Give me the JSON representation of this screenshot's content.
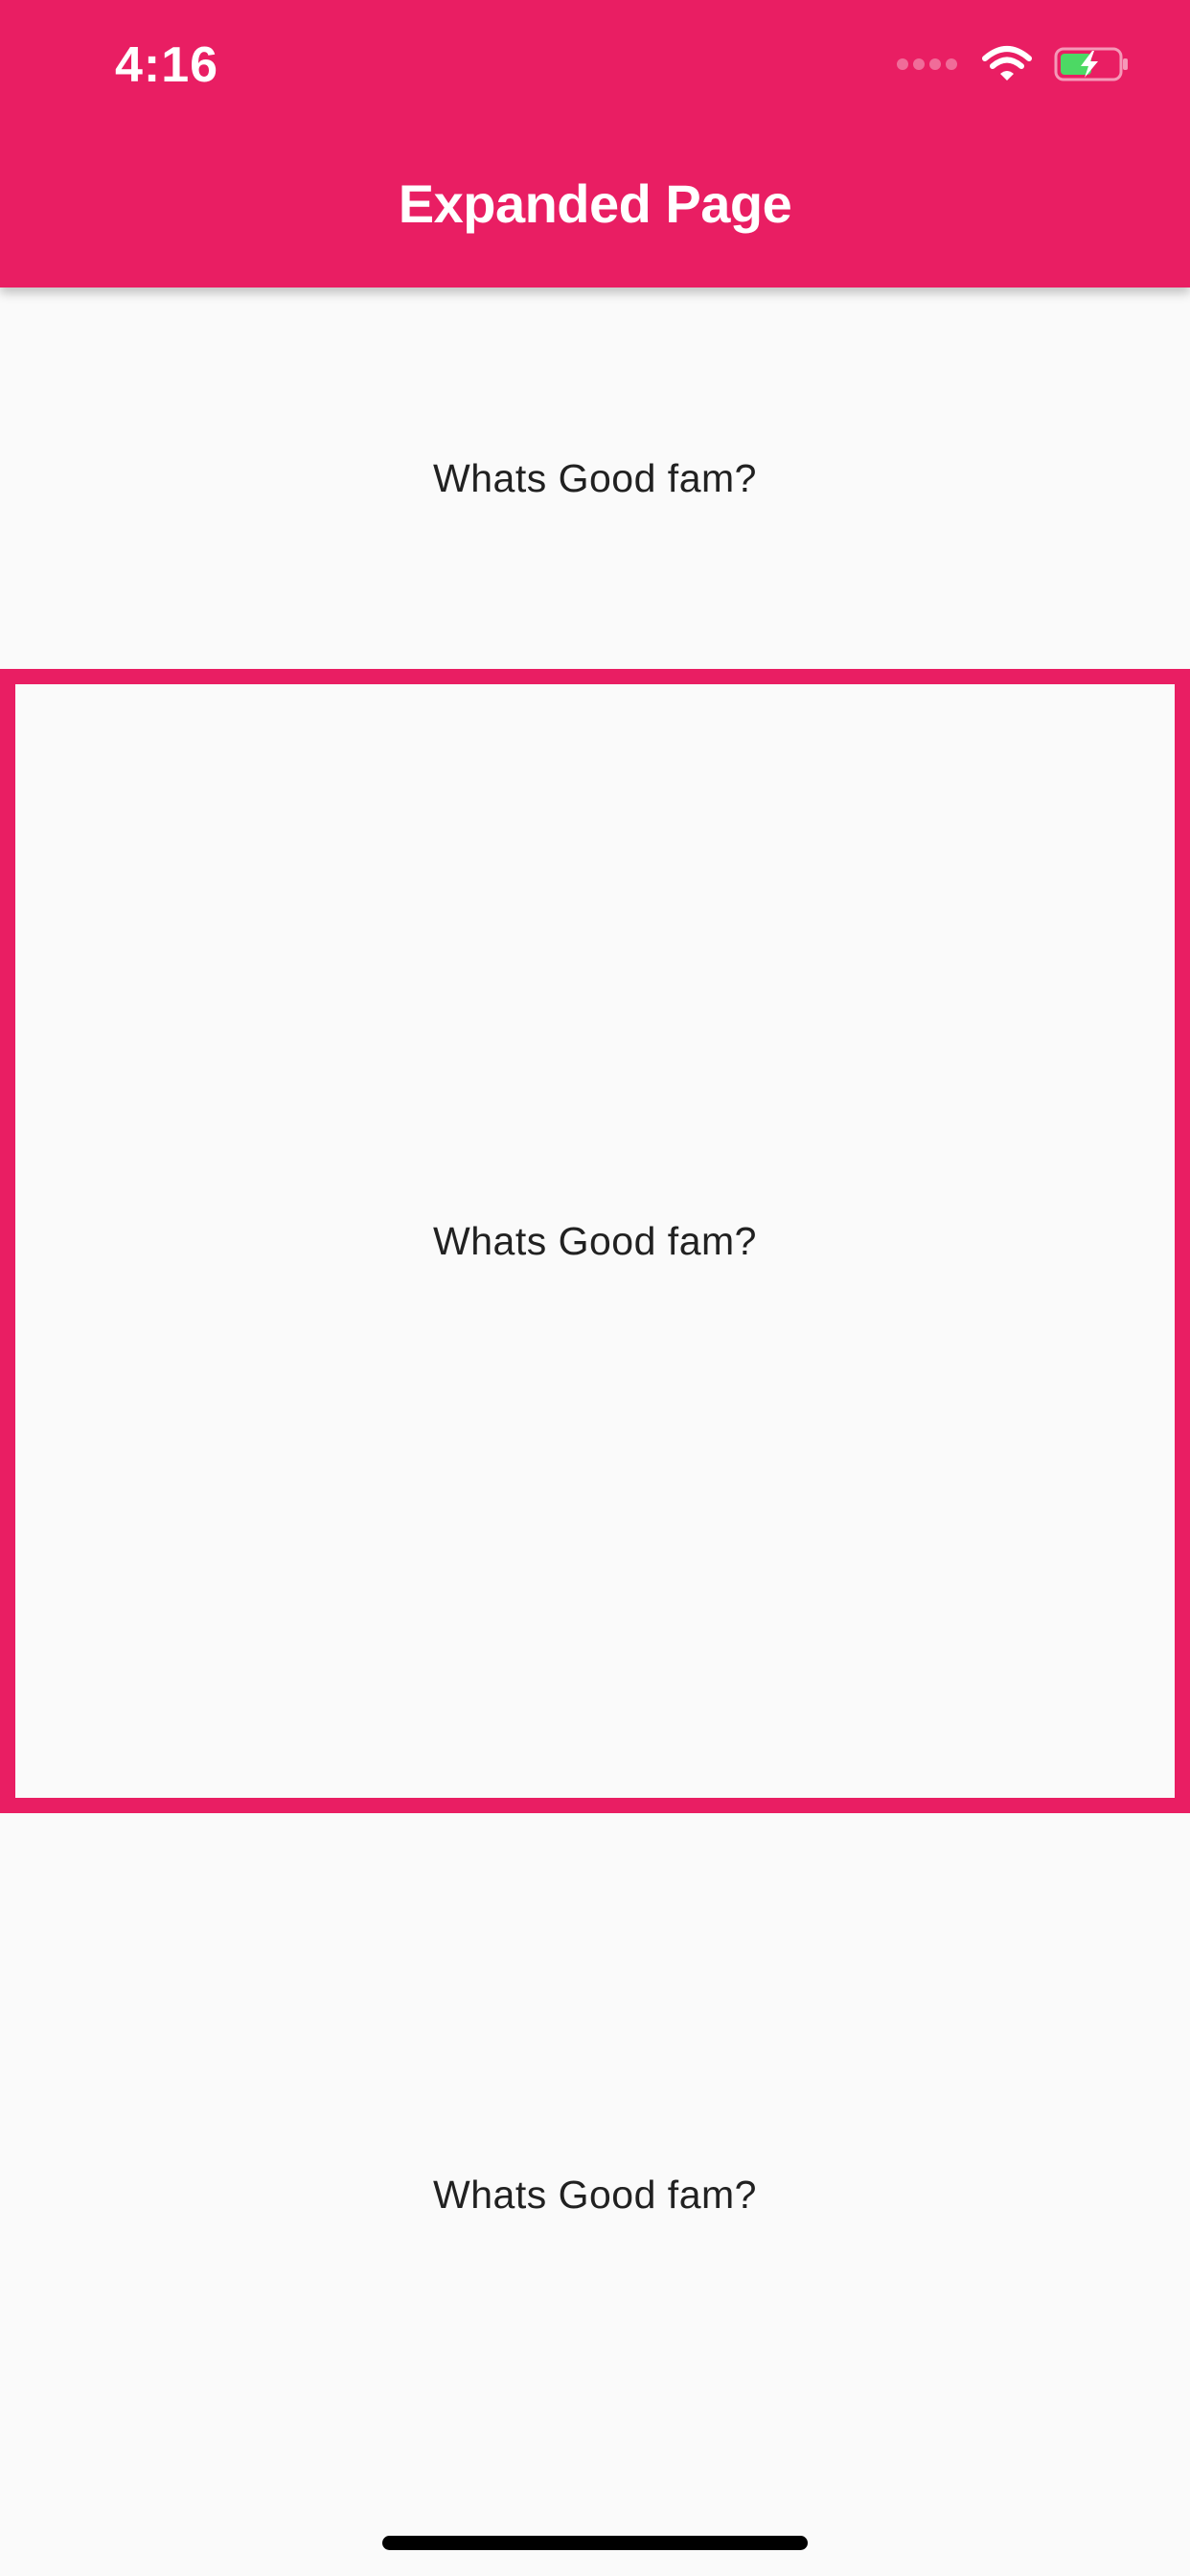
{
  "status_bar": {
    "time": "4:16",
    "icons": [
      "signal-icon",
      "wifi-icon",
      "battery-charging-icon"
    ]
  },
  "app_bar": {
    "title": "Expanded Page",
    "color": "#e91e63"
  },
  "sections": [
    {
      "text": "Whats Good fam?"
    },
    {
      "text": "Whats Good fam?",
      "highlighted": true
    },
    {
      "text": "Whats Good fam?"
    }
  ],
  "colors": {
    "accent": "#e91e63",
    "background": "#fafafa",
    "text": "#212121",
    "battery_fill": "#4cd964"
  }
}
